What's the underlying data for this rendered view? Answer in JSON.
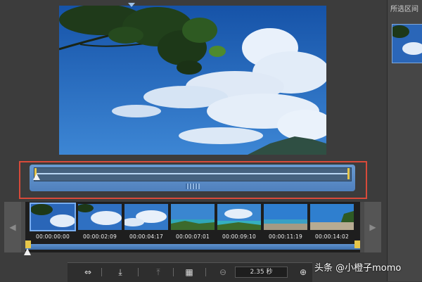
{
  "right_panel": {
    "header": "所选区间"
  },
  "filmstrip": {
    "timecodes": [
      "00:00:00:00",
      "00:00:02:09",
      "00:00:04:17",
      "00:00:07:01",
      "00:00:09:10",
      "00:00:11:19",
      "00:00:14:02"
    ],
    "prev_icon": "chevron-left-icon",
    "next_icon": "chevron-right-icon"
  },
  "toolbar": {
    "zoom_value": "2.35 秒"
  },
  "watermark": "头条 @小橙子momo"
}
